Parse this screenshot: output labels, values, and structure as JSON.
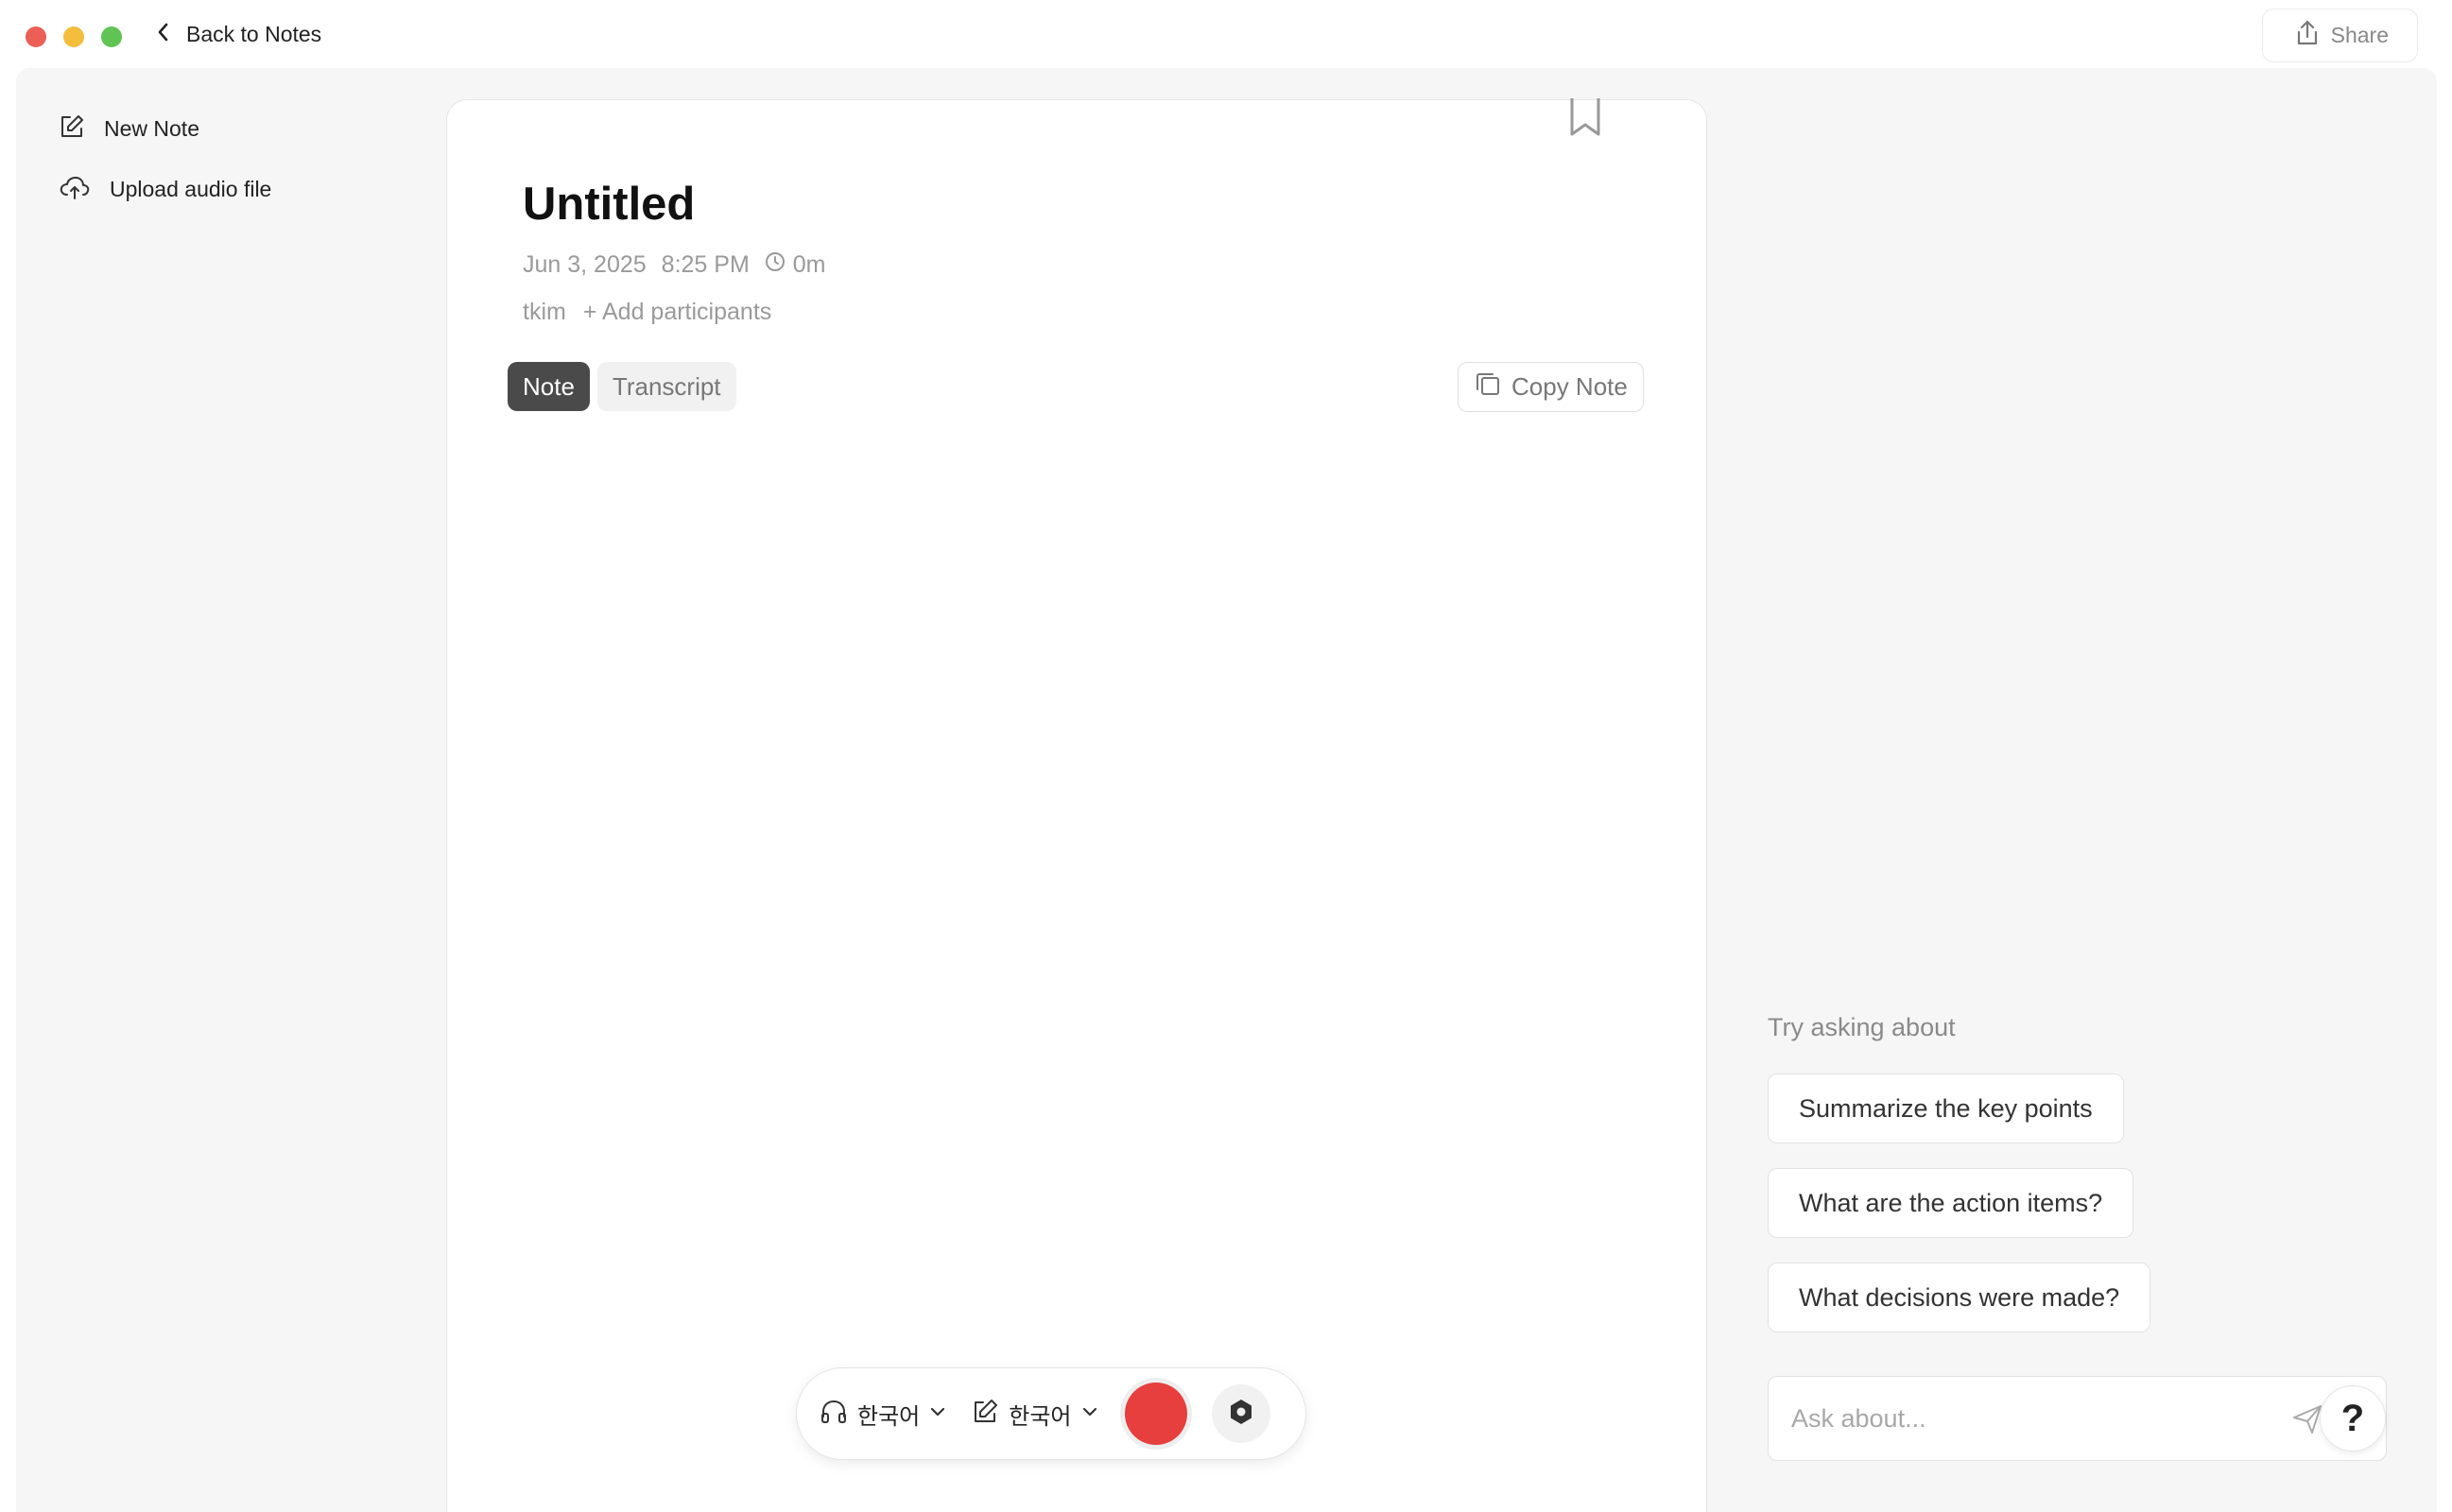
{
  "window": {
    "back_label": "Back to Notes",
    "share_label": "Share"
  },
  "sidebar": {
    "items": [
      {
        "label": "New Note",
        "icon": "edit-square-icon"
      },
      {
        "label": "Upload audio file",
        "icon": "cloud-upload-icon"
      }
    ]
  },
  "note": {
    "title": "Untitled",
    "date": "Jun 3, 2025",
    "time": "8:25 PM",
    "duration": "0m",
    "owner": "tkim",
    "add_participants": "+ Add participants",
    "tabs": [
      {
        "label": "Note",
        "active": true
      },
      {
        "label": "Transcript",
        "active": false
      }
    ],
    "copy_label": "Copy Note"
  },
  "controls": {
    "audio_language": "한국어",
    "note_language": "한국어",
    "record_color": "#e63f3d"
  },
  "assistant": {
    "heading": "Try asking about",
    "suggestions": [
      "Summarize the key points",
      "What are the action items?",
      "What decisions were made?"
    ],
    "ask_placeholder": "Ask about...",
    "help_label": "?"
  }
}
